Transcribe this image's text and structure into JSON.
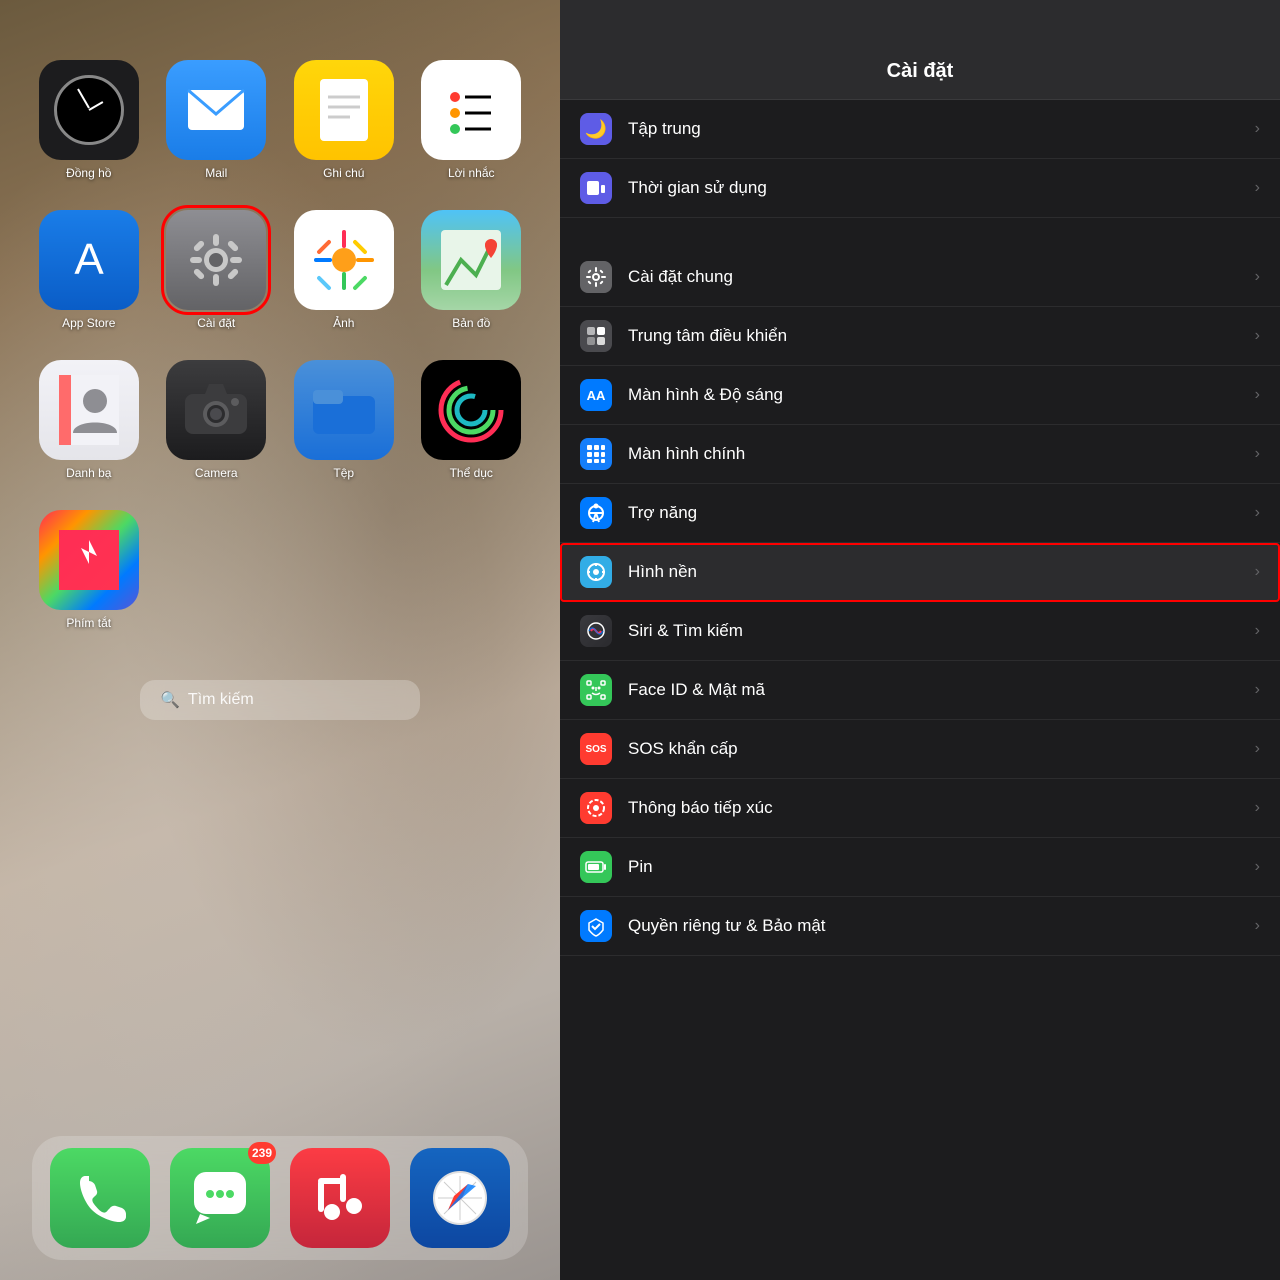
{
  "left": {
    "apps": [
      {
        "id": "clock",
        "label": "Đồng hồ",
        "selected": false
      },
      {
        "id": "mail",
        "label": "Mail",
        "selected": false
      },
      {
        "id": "notes",
        "label": "Ghi chú",
        "selected": false
      },
      {
        "id": "reminders",
        "label": "Lời nhắc",
        "selected": false
      },
      {
        "id": "appstore",
        "label": "App Store",
        "selected": false
      },
      {
        "id": "settings",
        "label": "Cài đặt",
        "selected": true
      },
      {
        "id": "photos",
        "label": "Ảnh",
        "selected": false
      },
      {
        "id": "maps",
        "label": "Bản đồ",
        "selected": false
      },
      {
        "id": "contacts",
        "label": "Danh bạ",
        "selected": false
      },
      {
        "id": "camera",
        "label": "Camera",
        "selected": false
      },
      {
        "id": "files",
        "label": "Tệp",
        "selected": false
      },
      {
        "id": "fitness",
        "label": "Thể dục",
        "selected": false
      },
      {
        "id": "shortcuts",
        "label": "Phím tắt",
        "selected": false
      }
    ],
    "search": "Tìm kiếm",
    "dock": [
      {
        "id": "phone",
        "label": "Phone",
        "badge": null
      },
      {
        "id": "messages",
        "label": "Messages",
        "badge": "239"
      },
      {
        "id": "music",
        "label": "Music",
        "badge": null
      },
      {
        "id": "safari",
        "label": "Safari",
        "badge": null
      }
    ]
  },
  "right": {
    "title": "Cài đặt",
    "items": [
      {
        "id": "focus",
        "label": "Tập trung",
        "icon": "🌙",
        "iconBg": "icon-bg-purple",
        "highlighted": false
      },
      {
        "id": "screentime",
        "label": "Thời gian sử dụng",
        "icon": "⏳",
        "iconBg": "icon-bg-purple2",
        "highlighted": false
      },
      {
        "id": "general",
        "label": "Cài đặt chung",
        "icon": "⚙️",
        "iconBg": "icon-bg-gray",
        "highlighted": false
      },
      {
        "id": "controlcenter",
        "label": "Trung tâm điều khiển",
        "icon": "⚙",
        "iconBg": "icon-bg-gray2",
        "highlighted": false
      },
      {
        "id": "display",
        "label": "Màn hình & Độ sáng",
        "icon": "AA",
        "iconBg": "icon-bg-blue",
        "highlighted": false
      },
      {
        "id": "homescreen",
        "label": "Màn hình chính",
        "icon": "⠿",
        "iconBg": "icon-bg-blue2",
        "highlighted": false
      },
      {
        "id": "accessibility",
        "label": "Trợ năng",
        "icon": "♿",
        "iconBg": "icon-bg-blue",
        "highlighted": false
      },
      {
        "id": "wallpaper",
        "label": "Hình nền",
        "icon": "✿",
        "iconBg": "icon-bg-teal",
        "highlighted": true
      },
      {
        "id": "siri",
        "label": "Siri & Tìm kiếm",
        "icon": "◉",
        "iconBg": "icon-bg-siri",
        "highlighted": false
      },
      {
        "id": "faceid",
        "label": "Face ID & Mật mã",
        "icon": "🙂",
        "iconBg": "icon-bg-green",
        "highlighted": false
      },
      {
        "id": "sos",
        "label": "SOS khẩn cấp",
        "icon": "SOS",
        "iconBg": "icon-bg-red",
        "highlighted": false
      },
      {
        "id": "exposure",
        "label": "Thông báo tiếp xúc",
        "icon": "◎",
        "iconBg": "icon-bg-red",
        "highlighted": false
      },
      {
        "id": "battery",
        "label": "Pin",
        "icon": "▬",
        "iconBg": "icon-bg-green",
        "highlighted": false
      },
      {
        "id": "privacy",
        "label": "Quyền riêng tư & Bảo mật",
        "icon": "✋",
        "iconBg": "icon-bg-blue",
        "highlighted": false
      }
    ]
  }
}
